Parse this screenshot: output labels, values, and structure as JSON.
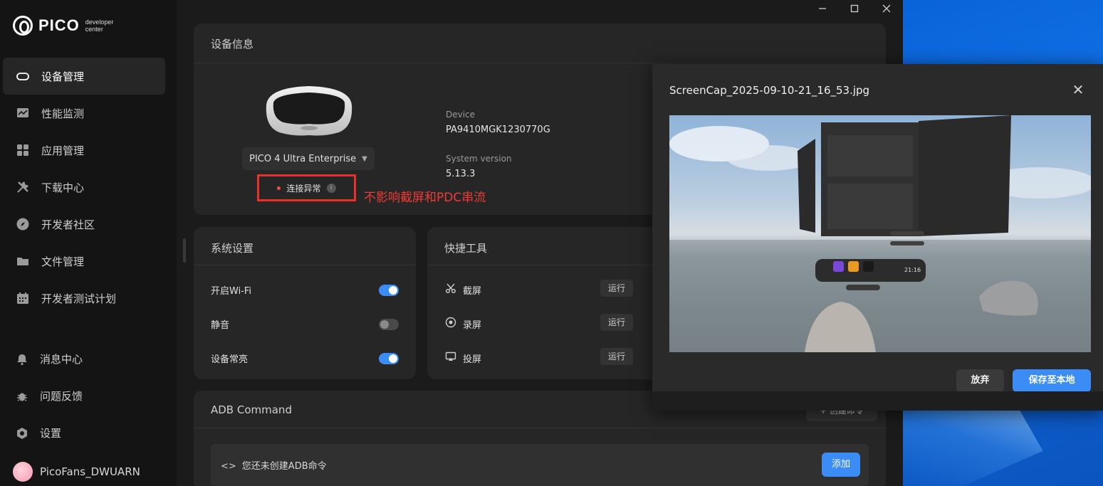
{
  "app": {
    "logo_text": "PICO",
    "logo_sub": "developer center"
  },
  "sidebar": {
    "items": [
      {
        "label": "设备管理",
        "icon": "headset-icon",
        "active": true
      },
      {
        "label": "性能监测",
        "icon": "chart-icon"
      },
      {
        "label": "应用管理",
        "icon": "grid-icon"
      },
      {
        "label": "下载中心",
        "icon": "tools-icon"
      },
      {
        "label": "开发者社区",
        "icon": "compass-icon"
      },
      {
        "label": "文件管理",
        "icon": "folder-icon"
      },
      {
        "label": "开发者测试计划",
        "icon": "calendar-icon"
      }
    ],
    "bottom": [
      {
        "label": "消息中心",
        "icon": "bell-icon"
      },
      {
        "label": "问题反馈",
        "icon": "bug-icon"
      },
      {
        "label": "设置",
        "icon": "gear-icon"
      }
    ],
    "user": {
      "name": "PicoFans_DWUARN"
    }
  },
  "device_info": {
    "title": "设备信息",
    "model": "PICO 4 Ultra Enterprise",
    "status": "连接异常",
    "annotation": "不影响截屏和PDC串流",
    "device_label": "Device",
    "device_value": "PA9410MGK1230770G",
    "system_label": "System version",
    "system_value": "5.13.3"
  },
  "system_settings": {
    "title": "系统设置",
    "rows": [
      {
        "label": "开启Wi-Fi",
        "on": true
      },
      {
        "label": "静音",
        "on": false
      },
      {
        "label": "设备常亮",
        "on": true
      }
    ]
  },
  "quick_tools": {
    "title": "快捷工具",
    "run_label": "运行",
    "tools": [
      {
        "label": "截屏",
        "icon": "scissors-icon"
      },
      {
        "label": "录屏",
        "icon": "record-icon"
      },
      {
        "label": "投屏",
        "icon": "cast-icon"
      }
    ]
  },
  "adb": {
    "title": "ADB Command",
    "create_label": "+ 创建命令",
    "empty_text": "您还未创建ADB命令",
    "add_label": "添加"
  },
  "dialog": {
    "title": "ScreenCap_2025-09-10-21_16_53.jpg",
    "discard_label": "放弃",
    "save_label": "保存至本地",
    "time_in_preview": "21:16"
  },
  "colors": {
    "accent": "#3b8cf5",
    "danger": "#e8302f",
    "bg": "#1b1b1b",
    "card": "#262626"
  }
}
